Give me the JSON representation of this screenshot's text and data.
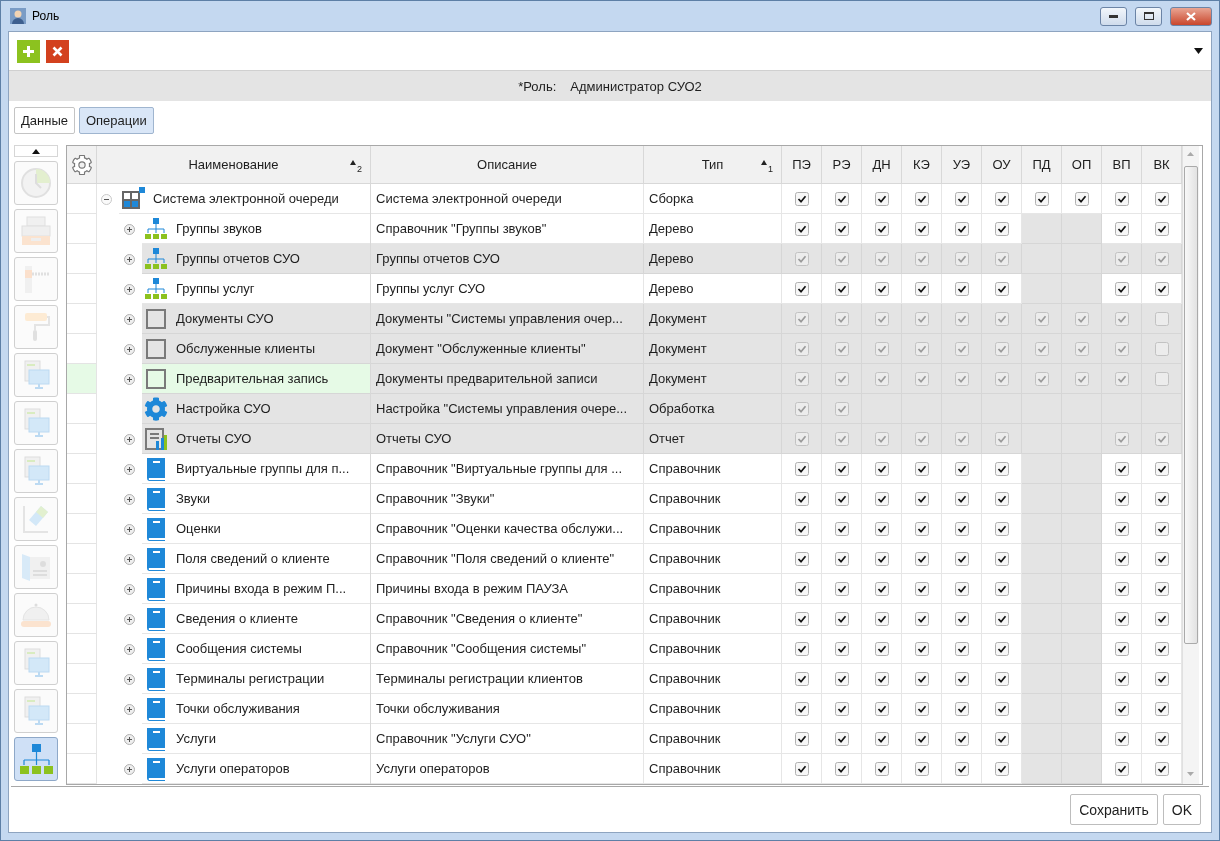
{
  "window": {
    "title": "Роль"
  },
  "toolbar": {
    "buttons": [
      {
        "kind": "add"
      },
      {
        "kind": "delete"
      }
    ]
  },
  "role": {
    "label": "*Роль:",
    "value": "Администратор СУО2"
  },
  "tabs": [
    {
      "label": "Данные",
      "selected": false
    },
    {
      "label": "Операции",
      "selected": true
    }
  ],
  "sidebar": {
    "items": [
      {
        "kind": "clock",
        "selected": false
      },
      {
        "kind": "printer",
        "selected": false
      },
      {
        "kind": "barrier",
        "selected": false
      },
      {
        "kind": "roller",
        "selected": false
      },
      {
        "kind": "monitor",
        "selected": false
      },
      {
        "kind": "monitor",
        "selected": false
      },
      {
        "kind": "monitor",
        "selected": false
      },
      {
        "kind": "eraser",
        "selected": false
      },
      {
        "kind": "card",
        "selected": false
      },
      {
        "kind": "bell",
        "selected": false
      },
      {
        "kind": "monitor",
        "selected": false
      },
      {
        "kind": "monitor",
        "selected": false
      },
      {
        "kind": "tree",
        "selected": true
      }
    ]
  },
  "table": {
    "columns": {
      "name": "Наименование",
      "name_sort": "2",
      "description": "Описание",
      "type": "Тип",
      "type_sort": "1",
      "permissions": [
        "ПЭ",
        "РЭ",
        "ДН",
        "КЭ",
        "УЭ",
        "ОУ",
        "ПД",
        "ОП",
        "ВП",
        "ВК"
      ]
    },
    "rows": [
      {
        "name": "Система электронной очереди",
        "description": "Система электронной очереди",
        "type": "Сборка",
        "kind": "assembly",
        "expanded": true,
        "disabled": false,
        "selected": false,
        "perms": [
          {
            "kind": "check",
            "checked": true
          },
          {
            "kind": "check",
            "checked": true
          },
          {
            "kind": "check",
            "checked": true
          },
          {
            "kind": "check",
            "checked": true
          },
          {
            "kind": "check",
            "checked": true
          },
          {
            "kind": "check",
            "checked": true
          },
          {
            "kind": "check",
            "checked": true
          },
          {
            "kind": "check",
            "checked": true
          },
          {
            "kind": "check",
            "checked": true
          },
          {
            "kind": "check",
            "checked": true
          }
        ],
        "children": [
          {
            "name": "Группы звуков",
            "description": "Справочник \"Группы звуков\"",
            "type": "Дерево",
            "kind": "tree",
            "expanded": false,
            "disabled": false,
            "selected": false,
            "perms": [
              {
                "kind": "check",
                "checked": true
              },
              {
                "kind": "check",
                "checked": true
              },
              {
                "kind": "check",
                "checked": true
              },
              {
                "kind": "check",
                "checked": true
              },
              {
                "kind": "check",
                "checked": true
              },
              {
                "kind": "check",
                "checked": true
              },
              {
                "kind": "blank"
              },
              {
                "kind": "blank"
              },
              {
                "kind": "check",
                "checked": true
              },
              {
                "kind": "check",
                "checked": true
              }
            ]
          },
          {
            "name": "Группы отчетов СУО",
            "description": "Группы отчетов СУО",
            "type": "Дерево",
            "kind": "tree",
            "expanded": false,
            "disabled": true,
            "selected": false,
            "perms": [
              {
                "kind": "check",
                "checked": true
              },
              {
                "kind": "check",
                "checked": true
              },
              {
                "kind": "check",
                "checked": true
              },
              {
                "kind": "check",
                "checked": true
              },
              {
                "kind": "check",
                "checked": true
              },
              {
                "kind": "check",
                "checked": true
              },
              {
                "kind": "blank"
              },
              {
                "kind": "blank"
              },
              {
                "kind": "check",
                "checked": true
              },
              {
                "kind": "check",
                "checked": true
              }
            ]
          },
          {
            "name": "Группы услуг",
            "description": "Группы услуг СУО",
            "type": "Дерево",
            "kind": "tree",
            "expanded": false,
            "disabled": false,
            "selected": false,
            "perms": [
              {
                "kind": "check",
                "checked": true
              },
              {
                "kind": "check",
                "checked": true
              },
              {
                "kind": "check",
                "checked": true
              },
              {
                "kind": "check",
                "checked": true
              },
              {
                "kind": "check",
                "checked": true
              },
              {
                "kind": "check",
                "checked": true
              },
              {
                "kind": "blank"
              },
              {
                "kind": "blank"
              },
              {
                "kind": "check",
                "checked": true
              },
              {
                "kind": "check",
                "checked": true
              }
            ]
          },
          {
            "name": "Документы СУО",
            "description": "Документы \"Системы управления очер...",
            "type": "Документ",
            "kind": "document",
            "expanded": false,
            "disabled": true,
            "selected": false,
            "perms": [
              {
                "kind": "check",
                "checked": true
              },
              {
                "kind": "check",
                "checked": true
              },
              {
                "kind": "check",
                "checked": true
              },
              {
                "kind": "check",
                "checked": true
              },
              {
                "kind": "check",
                "checked": true
              },
              {
                "kind": "check",
                "checked": true
              },
              {
                "kind": "check",
                "checked": true
              },
              {
                "kind": "check",
                "checked": true
              },
              {
                "kind": "check",
                "checked": true
              },
              {
                "kind": "check",
                "checked": false
              }
            ]
          },
          {
            "name": "Обслуженные клиенты",
            "description": "Документ \"Обслуженные клиенты\"",
            "type": "Документ",
            "kind": "document",
            "expanded": false,
            "disabled": true,
            "selected": false,
            "perms": [
              {
                "kind": "check",
                "checked": true
              },
              {
                "kind": "check",
                "checked": true
              },
              {
                "kind": "check",
                "checked": true
              },
              {
                "kind": "check",
                "checked": true
              },
              {
                "kind": "check",
                "checked": true
              },
              {
                "kind": "check",
                "checked": true
              },
              {
                "kind": "check",
                "checked": true
              },
              {
                "kind": "check",
                "checked": true
              },
              {
                "kind": "check",
                "checked": true
              },
              {
                "kind": "check",
                "checked": false
              }
            ]
          },
          {
            "name": "Предварительная запись",
            "description": "Документы предварительной записи",
            "type": "Документ",
            "kind": "document",
            "expanded": false,
            "disabled": true,
            "selected": true,
            "perms": [
              {
                "kind": "check",
                "checked": true
              },
              {
                "kind": "check",
                "checked": true
              },
              {
                "kind": "check",
                "checked": true
              },
              {
                "kind": "check",
                "checked": true
              },
              {
                "kind": "check",
                "checked": true
              },
              {
                "kind": "check",
                "checked": true
              },
              {
                "kind": "check",
                "checked": true
              },
              {
                "kind": "check",
                "checked": true
              },
              {
                "kind": "check",
                "checked": true
              },
              {
                "kind": "check",
                "checked": false
              }
            ]
          },
          {
            "name": "Настройка СУО",
            "description": "Настройка \"Системы управления очере...",
            "type": "Обработка",
            "kind": "gear",
            "disabled": true,
            "selected": false,
            "perms": [
              {
                "kind": "check",
                "checked": true
              },
              {
                "kind": "check",
                "checked": true
              },
              {
                "kind": "blank"
              },
              {
                "kind": "blank"
              },
              {
                "kind": "blank"
              },
              {
                "kind": "blank"
              },
              {
                "kind": "blank"
              },
              {
                "kind": "blank"
              },
              {
                "kind": "blank"
              },
              {
                "kind": "blank"
              }
            ]
          },
          {
            "name": "Отчеты СУО",
            "description": "Отчеты СУО",
            "type": "Отчет",
            "kind": "report",
            "expanded": false,
            "disabled": true,
            "selected": false,
            "perms": [
              {
                "kind": "check",
                "checked": true
              },
              {
                "kind": "check",
                "checked": true
              },
              {
                "kind": "check",
                "checked": true
              },
              {
                "kind": "check",
                "checked": true
              },
              {
                "kind": "check",
                "checked": true
              },
              {
                "kind": "check",
                "checked": true
              },
              {
                "kind": "blank"
              },
              {
                "kind": "blank"
              },
              {
                "kind": "check",
                "checked": true
              },
              {
                "kind": "check",
                "checked": true
              }
            ]
          },
          {
            "name": "Виртуальные группы для п...",
            "description": "Справочник \"Виртуальные группы для ...",
            "type": "Справочник",
            "kind": "book",
            "expanded": false,
            "disabled": false,
            "selected": false,
            "perms": [
              {
                "kind": "check",
                "checked": true
              },
              {
                "kind": "check",
                "checked": true
              },
              {
                "kind": "check",
                "checked": true
              },
              {
                "kind": "check",
                "checked": true
              },
              {
                "kind": "check",
                "checked": true
              },
              {
                "kind": "check",
                "checked": true
              },
              {
                "kind": "blank"
              },
              {
                "kind": "blank"
              },
              {
                "kind": "check",
                "checked": true
              },
              {
                "kind": "check",
                "checked": true
              }
            ]
          },
          {
            "name": "Звуки",
            "description": "Справочник \"Звуки\"",
            "type": "Справочник",
            "kind": "book",
            "expanded": false,
            "disabled": false,
            "selected": false,
            "perms": [
              {
                "kind": "check",
                "checked": true
              },
              {
                "kind": "check",
                "checked": true
              },
              {
                "kind": "check",
                "checked": true
              },
              {
                "kind": "check",
                "checked": true
              },
              {
                "kind": "check",
                "checked": true
              },
              {
                "kind": "check",
                "checked": true
              },
              {
                "kind": "blank"
              },
              {
                "kind": "blank"
              },
              {
                "kind": "check",
                "checked": true
              },
              {
                "kind": "check",
                "checked": true
              }
            ]
          },
          {
            "name": "Оценки",
            "description": "Справочник \"Оценки качества обслужи...",
            "type": "Справочник",
            "kind": "book",
            "expanded": false,
            "disabled": false,
            "selected": false,
            "perms": [
              {
                "kind": "check",
                "checked": true
              },
              {
                "kind": "check",
                "checked": true
              },
              {
                "kind": "check",
                "checked": true
              },
              {
                "kind": "check",
                "checked": true
              },
              {
                "kind": "check",
                "checked": true
              },
              {
                "kind": "check",
                "checked": true
              },
              {
                "kind": "blank"
              },
              {
                "kind": "blank"
              },
              {
                "kind": "check",
                "checked": true
              },
              {
                "kind": "check",
                "checked": true
              }
            ]
          },
          {
            "name": "Поля сведений о клиенте",
            "description": "Справочник \"Поля сведений о клиенте\"",
            "type": "Справочник",
            "kind": "book",
            "expanded": false,
            "disabled": false,
            "selected": false,
            "perms": [
              {
                "kind": "check",
                "checked": true
              },
              {
                "kind": "check",
                "checked": true
              },
              {
                "kind": "check",
                "checked": true
              },
              {
                "kind": "check",
                "checked": true
              },
              {
                "kind": "check",
                "checked": true
              },
              {
                "kind": "check",
                "checked": true
              },
              {
                "kind": "blank"
              },
              {
                "kind": "blank"
              },
              {
                "kind": "check",
                "checked": true
              },
              {
                "kind": "check",
                "checked": true
              }
            ]
          },
          {
            "name": "Причины входа в режим П...",
            "description": "Причины входа в режим ПАУЗА",
            "type": "Справочник",
            "kind": "book",
            "expanded": false,
            "disabled": false,
            "selected": false,
            "perms": [
              {
                "kind": "check",
                "checked": true
              },
              {
                "kind": "check",
                "checked": true
              },
              {
                "kind": "check",
                "checked": true
              },
              {
                "kind": "check",
                "checked": true
              },
              {
                "kind": "check",
                "checked": true
              },
              {
                "kind": "check",
                "checked": true
              },
              {
                "kind": "blank"
              },
              {
                "kind": "blank"
              },
              {
                "kind": "check",
                "checked": true
              },
              {
                "kind": "check",
                "checked": true
              }
            ]
          },
          {
            "name": "Сведения о клиенте",
            "description": "Справочник \"Сведения о клиенте\"",
            "type": "Справочник",
            "kind": "book",
            "expanded": false,
            "disabled": false,
            "selected": false,
            "perms": [
              {
                "kind": "check",
                "checked": true
              },
              {
                "kind": "check",
                "checked": true
              },
              {
                "kind": "check",
                "checked": true
              },
              {
                "kind": "check",
                "checked": true
              },
              {
                "kind": "check",
                "checked": true
              },
              {
                "kind": "check",
                "checked": true
              },
              {
                "kind": "blank"
              },
              {
                "kind": "blank"
              },
              {
                "kind": "check",
                "checked": true
              },
              {
                "kind": "check",
                "checked": true
              }
            ]
          },
          {
            "name": "Сообщения системы",
            "description": "Справочник \"Сообщения системы\"",
            "type": "Справочник",
            "kind": "book",
            "expanded": false,
            "disabled": false,
            "selected": false,
            "perms": [
              {
                "kind": "check",
                "checked": true
              },
              {
                "kind": "check",
                "checked": true
              },
              {
                "kind": "check",
                "checked": true
              },
              {
                "kind": "check",
                "checked": true
              },
              {
                "kind": "check",
                "checked": true
              },
              {
                "kind": "check",
                "checked": true
              },
              {
                "kind": "blank"
              },
              {
                "kind": "blank"
              },
              {
                "kind": "check",
                "checked": true
              },
              {
                "kind": "check",
                "checked": true
              }
            ]
          },
          {
            "name": "Терминалы регистрации",
            "description": "Терминалы регистрации клиентов",
            "type": "Справочник",
            "kind": "book",
            "expanded": false,
            "disabled": false,
            "selected": false,
            "perms": [
              {
                "kind": "check",
                "checked": true
              },
              {
                "kind": "check",
                "checked": true
              },
              {
                "kind": "check",
                "checked": true
              },
              {
                "kind": "check",
                "checked": true
              },
              {
                "kind": "check",
                "checked": true
              },
              {
                "kind": "check",
                "checked": true
              },
              {
                "kind": "blank"
              },
              {
                "kind": "blank"
              },
              {
                "kind": "check",
                "checked": true
              },
              {
                "kind": "check",
                "checked": true
              }
            ]
          },
          {
            "name": "Точки обслуживания",
            "description": "Точки обслуживания",
            "type": "Справочник",
            "kind": "book",
            "expanded": false,
            "disabled": false,
            "selected": false,
            "perms": [
              {
                "kind": "check",
                "checked": true
              },
              {
                "kind": "check",
                "checked": true
              },
              {
                "kind": "check",
                "checked": true
              },
              {
                "kind": "check",
                "checked": true
              },
              {
                "kind": "check",
                "checked": true
              },
              {
                "kind": "check",
                "checked": true
              },
              {
                "kind": "blank"
              },
              {
                "kind": "blank"
              },
              {
                "kind": "check",
                "checked": true
              },
              {
                "kind": "check",
                "checked": true
              }
            ]
          },
          {
            "name": "Услуги",
            "description": "Справочник \"Услуги СУО\"",
            "type": "Справочник",
            "kind": "book",
            "expanded": false,
            "disabled": false,
            "selected": false,
            "perms": [
              {
                "kind": "check",
                "checked": true
              },
              {
                "kind": "check",
                "checked": true
              },
              {
                "kind": "check",
                "checked": true
              },
              {
                "kind": "check",
                "checked": true
              },
              {
                "kind": "check",
                "checked": true
              },
              {
                "kind": "check",
                "checked": true
              },
              {
                "kind": "blank"
              },
              {
                "kind": "blank"
              },
              {
                "kind": "check",
                "checked": true
              },
              {
                "kind": "check",
                "checked": true
              }
            ]
          },
          {
            "name": "Услуги операторов",
            "description": "Услуги операторов",
            "type": "Справочник",
            "kind": "book",
            "expanded": false,
            "disabled": false,
            "selected": false,
            "perms": [
              {
                "kind": "check",
                "checked": true
              },
              {
                "kind": "check",
                "checked": true
              },
              {
                "kind": "check",
                "checked": true
              },
              {
                "kind": "check",
                "checked": true
              },
              {
                "kind": "check",
                "checked": true
              },
              {
                "kind": "check",
                "checked": true
              },
              {
                "kind": "blank"
              },
              {
                "kind": "blank"
              },
              {
                "kind": "check",
                "checked": true
              },
              {
                "kind": "check",
                "checked": true
              }
            ]
          }
        ]
      }
    ]
  },
  "buttons": [
    "Сохранить",
    "OK"
  ]
}
